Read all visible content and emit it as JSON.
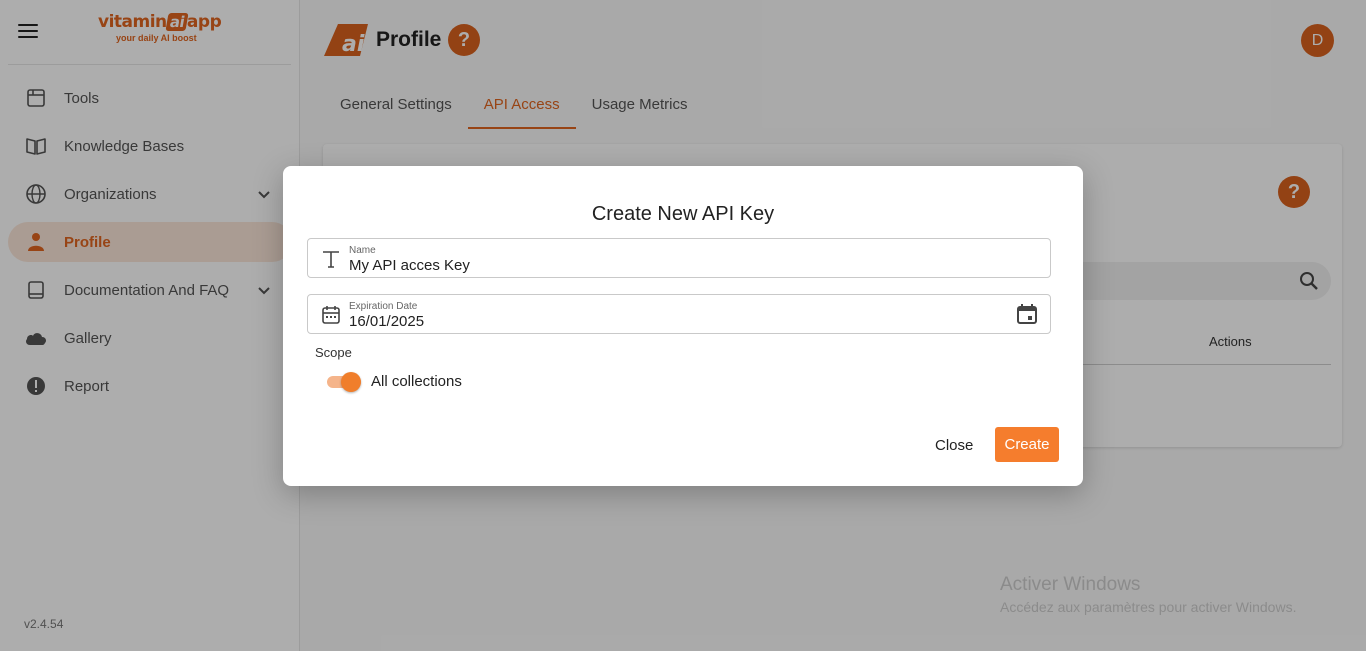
{
  "app": {
    "logo_text_pre": "vitamin",
    "logo_text_ai": "ai",
    "logo_text_post": "app",
    "logo_tagline": "your daily AI boost",
    "version": "v2.4.54"
  },
  "sidebar": {
    "items": [
      {
        "label": "Tools",
        "icon": "tools-window-icon"
      },
      {
        "label": "Knowledge Bases",
        "icon": "book-open-icon"
      },
      {
        "label": "Organizations",
        "icon": "globe-icon",
        "expandable": true
      },
      {
        "label": "Profile",
        "icon": "person-icon",
        "active": true
      },
      {
        "label": "Documentation And FAQ",
        "icon": "book-icon",
        "expandable": true
      },
      {
        "label": "Gallery",
        "icon": "cloud-icon"
      },
      {
        "label": "Report",
        "icon": "alert-icon"
      }
    ]
  },
  "header": {
    "title": "Profile",
    "help": "?",
    "avatar_initial": "D"
  },
  "tabs": [
    {
      "label": "General Settings"
    },
    {
      "label": "API Access",
      "active": true
    },
    {
      "label": "Usage Metrics"
    }
  ],
  "card": {
    "help": "?",
    "actions_header": "Actions"
  },
  "dialog": {
    "title": "Create New API Key",
    "name_label": "Name",
    "name_value": "My API acces Key",
    "expiration_label": "Expiration Date",
    "expiration_value": "16/01/2025",
    "scope_label": "Scope",
    "toggle_label": "All collections",
    "toggle_on": true,
    "close_label": "Close",
    "create_label": "Create"
  },
  "watermark": {
    "line1": "Activer Windows",
    "line2": "Accédez aux paramètres pour activer Windows."
  },
  "colors": {
    "accent": "#e0651f",
    "button": "#f57d2d"
  }
}
